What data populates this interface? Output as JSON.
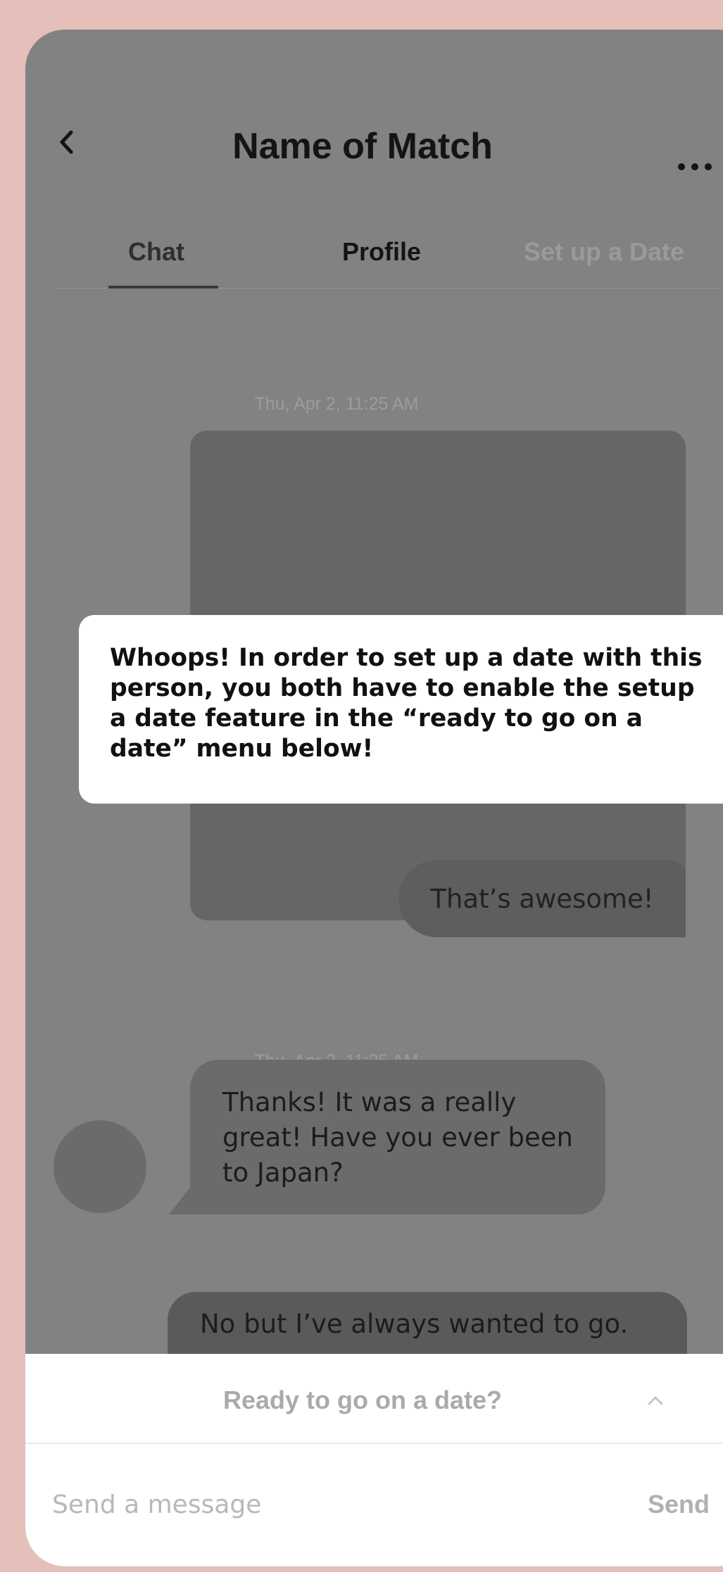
{
  "header": {
    "title": "Name of Match"
  },
  "tabs": [
    {
      "label": "Chat"
    },
    {
      "label": "Profile"
    },
    {
      "label": "Set up a Date"
    }
  ],
  "messages": {
    "timestamp_1": "Thu, Apr 2, 11:25 AM",
    "outgoing_1": "That’s awesome!",
    "timestamp_2": "Thu, Apr 2, 11:25 AM",
    "incoming_1": "Thanks! It was a really great! Have you ever been to Japan?",
    "outgoing_2": "No but I’ve always wanted to go."
  },
  "modal": {
    "text": "Whoops! In order to set up a date with this person, you both have to enable the setup a date feature in the “ready to go on a date” menu below!"
  },
  "bottom_sheet": {
    "title": "Ready to go on a date?",
    "input_placeholder": "Send a message",
    "send_label": "Send"
  }
}
